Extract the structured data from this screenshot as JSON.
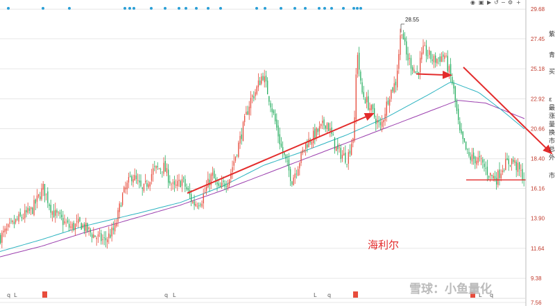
{
  "chart_data": {
    "type": "line",
    "title": "海利尔",
    "watermark": "雪球：小鱼量化",
    "y_ticks": [
      "29.68",
      "27.45",
      "25.18",
      "22.92",
      "20.66",
      "18.40",
      "16.16",
      "13.90",
      "11.64",
      "9.38",
      "7.56"
    ],
    "ylim": [
      7.5,
      29.9
    ],
    "grid": true,
    "high_label": "28.55",
    "colors": {
      "up": "#e74c3c",
      "down": "#27ae60",
      "ma_fast": "#2bb3c0",
      "ma_slow": "#9b3fae",
      "arrow": "#e32b2b",
      "axis_text": "#c0392b"
    },
    "price_key_points": [
      [
        0,
        12.5
      ],
      [
        25,
        13.8
      ],
      [
        45,
        14.5
      ],
      [
        62,
        16.2
      ],
      [
        75,
        14.4
      ],
      [
        100,
        13.2
      ],
      [
        115,
        13.5
      ],
      [
        135,
        12.6
      ],
      [
        150,
        12.2
      ],
      [
        165,
        13.1
      ],
      [
        175,
        15.5
      ],
      [
        190,
        17.2
      ],
      [
        205,
        15.9
      ],
      [
        220,
        17.5
      ],
      [
        235,
        17.8
      ],
      [
        250,
        16.1
      ],
      [
        262,
        16.8
      ],
      [
        278,
        15.0
      ],
      [
        290,
        15.3
      ],
      [
        305,
        17.2
      ],
      [
        315,
        16.0
      ],
      [
        330,
        17.0
      ],
      [
        345,
        19.8
      ],
      [
        360,
        22.8
      ],
      [
        368,
        23.5
      ],
      [
        378,
        24.8
      ],
      [
        390,
        22.5
      ],
      [
        405,
        19.2
      ],
      [
        420,
        16.8
      ],
      [
        428,
        17.8
      ],
      [
        440,
        19.5
      ],
      [
        455,
        20.3
      ],
      [
        470,
        21.2
      ],
      [
        485,
        19.0
      ],
      [
        500,
        18.4
      ],
      [
        510,
        20.5
      ],
      [
        514,
        26.9
      ],
      [
        520,
        23.5
      ],
      [
        535,
        22.0
      ],
      [
        548,
        20.7
      ],
      [
        560,
        23.2
      ],
      [
        570,
        24.2
      ],
      [
        578,
        28.4
      ],
      [
        585,
        26.2
      ],
      [
        600,
        24.8
      ],
      [
        610,
        26.6
      ],
      [
        625,
        25.8
      ],
      [
        640,
        26.2
      ],
      [
        652,
        24.0
      ],
      [
        662,
        20.3
      ],
      [
        675,
        18.5
      ],
      [
        690,
        18.3
      ],
      [
        705,
        17.2
      ],
      [
        715,
        16.9
      ],
      [
        725,
        17.9
      ],
      [
        738,
        18.3
      ],
      [
        755,
        16.9
      ]
    ],
    "ma_fast": [
      [
        0,
        11.4
      ],
      [
        60,
        12.3
      ],
      [
        120,
        13.3
      ],
      [
        200,
        14.3
      ],
      [
        260,
        15.1
      ],
      [
        320,
        16.3
      ],
      [
        380,
        17.9
      ],
      [
        440,
        19.0
      ],
      [
        500,
        20.2
      ],
      [
        560,
        21.6
      ],
      [
        620,
        23.3
      ],
      [
        650,
        24.2
      ],
      [
        690,
        23.4
      ],
      [
        720,
        22.2
      ],
      [
        757,
        20.6
      ]
    ],
    "ma_slow": [
      [
        0,
        11.0
      ],
      [
        60,
        11.8
      ],
      [
        120,
        12.8
      ],
      [
        200,
        14.0
      ],
      [
        260,
        14.9
      ],
      [
        320,
        16.0
      ],
      [
        380,
        17.2
      ],
      [
        440,
        18.4
      ],
      [
        500,
        19.6
      ],
      [
        560,
        20.8
      ],
      [
        620,
        22.0
      ],
      [
        660,
        22.8
      ],
      [
        700,
        22.6
      ],
      [
        757,
        21.4
      ]
    ],
    "support_price": 16.8,
    "arrows": [
      {
        "x1": 270,
        "y1": 15.8,
        "x2": 538,
        "y2": 21.8
      },
      {
        "x1": 600,
        "y1": 24.8,
        "x2": 650,
        "y2": 24.7
      },
      {
        "x1": 668,
        "y1": 25.3,
        "x2": 795,
        "y2": 18.8
      }
    ]
  }
}
